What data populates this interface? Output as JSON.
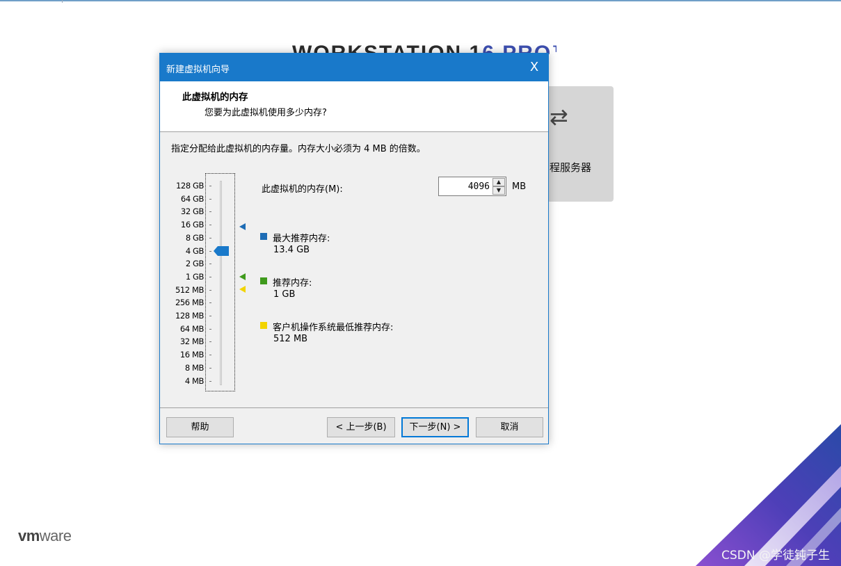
{
  "background": {
    "banner_text_dark": "WORKSTATION 1",
    "banner_text_accent": "6 PRO™",
    "card_icon": "arrow-transfer-icon",
    "card_label": "程服务器",
    "logo_bold": "vm",
    "logo_light": "ware",
    "watermark": "CSDN @学徒钝子生"
  },
  "dialog": {
    "title": "新建虚拟机向导",
    "close_glyph": "X",
    "header_title": "此虚拟机的内存",
    "header_subtitle": "您要为此虚拟机使用多少内存?",
    "description": "指定分配给此虚拟机的内存量。内存大小必须为 4 MB 的倍数。",
    "slider": {
      "ticks": [
        "128 GB",
        "64 GB",
        "32 GB",
        "16 GB",
        "8 GB",
        "4 GB",
        "2 GB",
        "1 GB",
        "512 MB",
        "256 MB",
        "128 MB",
        "64 MB",
        "32 MB",
        "16 MB",
        "8 MB",
        "4 MB"
      ],
      "selected": "4 GB"
    },
    "memory_label": "此虚拟机的内存(M):",
    "memory_value": "4096",
    "memory_unit": "MB",
    "legend": [
      {
        "label": "最大推荐内存:",
        "value": "13.4 GB",
        "color": "#1d6cb5"
      },
      {
        "label": "推荐内存:",
        "value": "1 GB",
        "color": "#3f9a1c"
      },
      {
        "label": "客户机操作系统最低推荐内存:",
        "value": "512 MB",
        "color": "#f2d400"
      }
    ],
    "buttons": {
      "help": "帮助",
      "back": "< 上一步(B)",
      "next": "下一步(N) >",
      "cancel": "取消"
    }
  }
}
